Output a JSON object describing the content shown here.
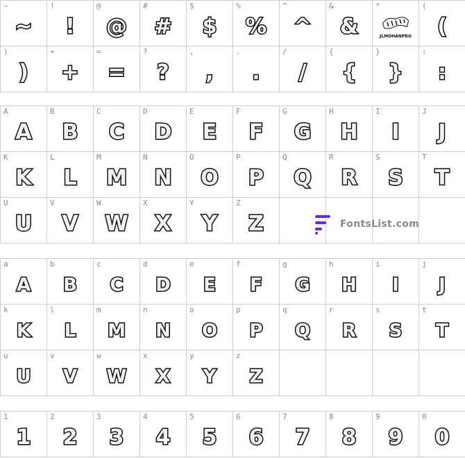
{
  "symbols": [
    {
      "label": "~",
      "glyph": "~"
    },
    {
      "label": "!",
      "glyph": "!"
    },
    {
      "label": "@",
      "glyph": "@"
    },
    {
      "label": "#",
      "glyph": "#"
    },
    {
      "label": "$",
      "glyph": "$"
    },
    {
      "label": "%",
      "glyph": "%"
    },
    {
      "label": "^",
      "glyph": "^"
    },
    {
      "label": "&",
      "glyph": "&"
    },
    {
      "label": "*",
      "glyph": "",
      "logo_text": "JLMOHANPRO"
    },
    {
      "label": "(",
      "glyph": "("
    },
    {
      "label": ")",
      "glyph": ")"
    },
    {
      "label": "+",
      "glyph": "+"
    },
    {
      "label": "=",
      "glyph": "="
    },
    {
      "label": "?",
      "glyph": "?"
    },
    {
      "label": ",",
      "glyph": ","
    },
    {
      "label": ".",
      "glyph": "."
    },
    {
      "label": "/",
      "glyph": "/"
    },
    {
      "label": "{",
      "glyph": "{"
    },
    {
      "label": "}",
      "glyph": "}"
    },
    {
      "label": ":",
      "glyph": ":"
    }
  ],
  "uppercase": [
    {
      "label": "A",
      "glyph": "A"
    },
    {
      "label": "B",
      "glyph": "B"
    },
    {
      "label": "C",
      "glyph": "C"
    },
    {
      "label": "D",
      "glyph": "D"
    },
    {
      "label": "E",
      "glyph": "E"
    },
    {
      "label": "F",
      "glyph": "F"
    },
    {
      "label": "G",
      "glyph": "G"
    },
    {
      "label": "H",
      "glyph": "H"
    },
    {
      "label": "I",
      "glyph": "I"
    },
    {
      "label": "J",
      "glyph": "J"
    },
    {
      "label": "K",
      "glyph": "K"
    },
    {
      "label": "L",
      "glyph": "L"
    },
    {
      "label": "M",
      "glyph": "M"
    },
    {
      "label": "N",
      "glyph": "N"
    },
    {
      "label": "O",
      "glyph": "O"
    },
    {
      "label": "P",
      "glyph": "P"
    },
    {
      "label": "Q",
      "glyph": "Q"
    },
    {
      "label": "R",
      "glyph": "R"
    },
    {
      "label": "S",
      "glyph": "S"
    },
    {
      "label": "T",
      "glyph": "T"
    },
    {
      "label": "U",
      "glyph": "U"
    },
    {
      "label": "V",
      "glyph": "V"
    },
    {
      "label": "W",
      "glyph": "W"
    },
    {
      "label": "X",
      "glyph": "X"
    },
    {
      "label": "Y",
      "glyph": "Y"
    },
    {
      "label": "Z",
      "glyph": "Z"
    },
    {
      "label": "",
      "glyph": ""
    },
    {
      "label": "",
      "glyph": ""
    },
    {
      "label": "",
      "glyph": ""
    },
    {
      "label": "",
      "glyph": ""
    }
  ],
  "lowercase": [
    {
      "label": "a",
      "glyph": "A"
    },
    {
      "label": "b",
      "glyph": "B"
    },
    {
      "label": "c",
      "glyph": "C"
    },
    {
      "label": "d",
      "glyph": "D"
    },
    {
      "label": "e",
      "glyph": "E"
    },
    {
      "label": "f",
      "glyph": "F"
    },
    {
      "label": "g",
      "glyph": "G"
    },
    {
      "label": "h",
      "glyph": "H"
    },
    {
      "label": "i",
      "glyph": "I"
    },
    {
      "label": "j",
      "glyph": "J"
    },
    {
      "label": "k",
      "glyph": "K"
    },
    {
      "label": "l",
      "glyph": "L"
    },
    {
      "label": "m",
      "glyph": "M"
    },
    {
      "label": "n",
      "glyph": "N"
    },
    {
      "label": "o",
      "glyph": "O"
    },
    {
      "label": "p",
      "glyph": "P"
    },
    {
      "label": "q",
      "glyph": "Q"
    },
    {
      "label": "r",
      "glyph": "R"
    },
    {
      "label": "s",
      "glyph": "S"
    },
    {
      "label": "t",
      "glyph": "T"
    },
    {
      "label": "u",
      "glyph": "U"
    },
    {
      "label": "v",
      "glyph": "V"
    },
    {
      "label": "w",
      "glyph": "W"
    },
    {
      "label": "x",
      "glyph": "X"
    },
    {
      "label": "y",
      "glyph": "Y"
    },
    {
      "label": "z",
      "glyph": "Z"
    },
    {
      "label": "",
      "glyph": ""
    },
    {
      "label": "",
      "glyph": ""
    },
    {
      "label": "",
      "glyph": ""
    },
    {
      "label": "",
      "glyph": ""
    }
  ],
  "digits": [
    {
      "label": "1",
      "glyph": "1"
    },
    {
      "label": "2",
      "glyph": "2"
    },
    {
      "label": "3",
      "glyph": "3"
    },
    {
      "label": "4",
      "glyph": "4"
    },
    {
      "label": "5",
      "glyph": "5"
    },
    {
      "label": "6",
      "glyph": "6"
    },
    {
      "label": "7",
      "glyph": "7"
    },
    {
      "label": "8",
      "glyph": "8"
    },
    {
      "label": "9",
      "glyph": "9"
    },
    {
      "label": "0",
      "glyph": "0"
    }
  ],
  "watermark": {
    "text": "FontsList.com",
    "color": "#6a28f0"
  }
}
